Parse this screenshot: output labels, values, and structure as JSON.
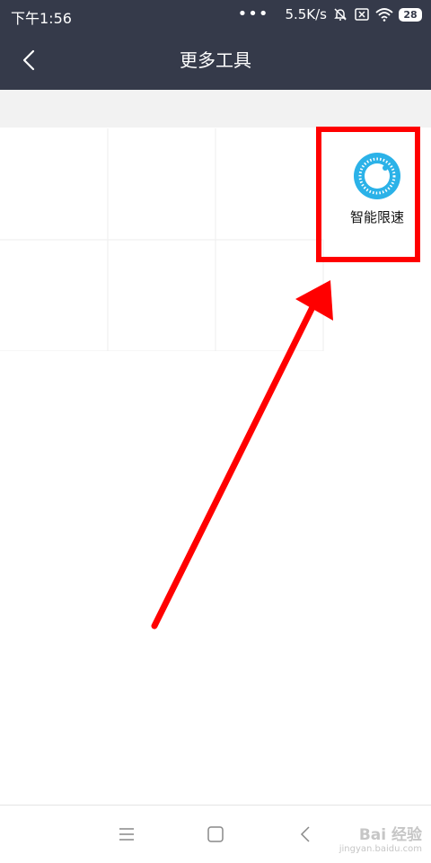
{
  "status_bar": {
    "time": "下午1:56",
    "dots": "•••",
    "speed": "5.5K/s",
    "battery": "28"
  },
  "nav": {
    "title": "更多工具"
  },
  "tools": [
    {
      "label": "智能限速",
      "icon": "speed-limit-dial-icon",
      "color": "#2bb2e8"
    }
  ],
  "annotation": {
    "highlight_color": "#ff0000"
  },
  "watermark": {
    "main": "Bai 经验",
    "sub": "jingyan.baidu.com"
  }
}
